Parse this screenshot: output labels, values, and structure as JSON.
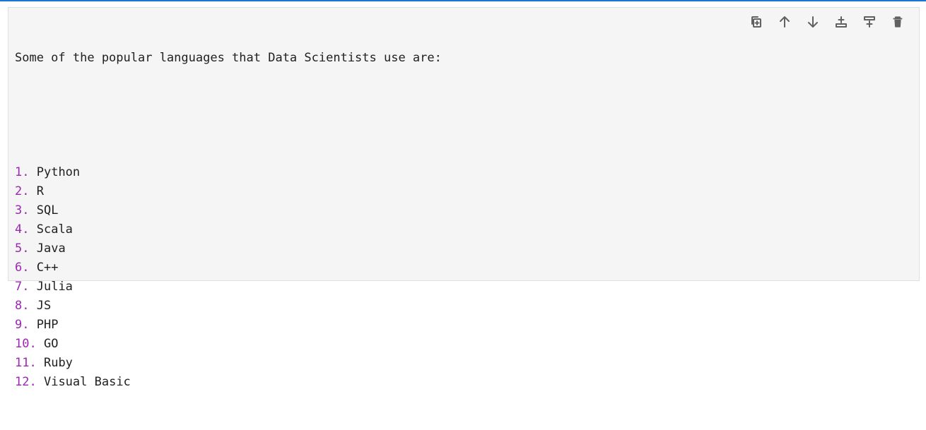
{
  "intro": "Some of the popular languages that Data Scientists use are:",
  "languages": [
    {
      "num": "1.",
      "name": "Python"
    },
    {
      "num": "2.",
      "name": "R"
    },
    {
      "num": "3.",
      "name": "SQL"
    },
    {
      "num": "4.",
      "name": "Scala"
    },
    {
      "num": "5.",
      "name": "Java"
    },
    {
      "num": "6.",
      "name": "C++"
    },
    {
      "num": "7.",
      "name": "Julia"
    },
    {
      "num": "8.",
      "name": "JS"
    },
    {
      "num": "9.",
      "name": "PHP"
    },
    {
      "num": "10.",
      "name": "GO"
    },
    {
      "num": "11.",
      "name": "Ruby"
    },
    {
      "num": "12.",
      "name": "Visual Basic"
    }
  ],
  "toolbar": {
    "icons": [
      "duplicate-icon",
      "move-up-icon",
      "move-down-icon",
      "insert-above-icon",
      "insert-below-icon",
      "delete-icon"
    ]
  },
  "colors": {
    "accent": "#1976d2",
    "list_number": "#9c27b0",
    "cell_background": "#f5f5f5",
    "icon": "#616161"
  }
}
